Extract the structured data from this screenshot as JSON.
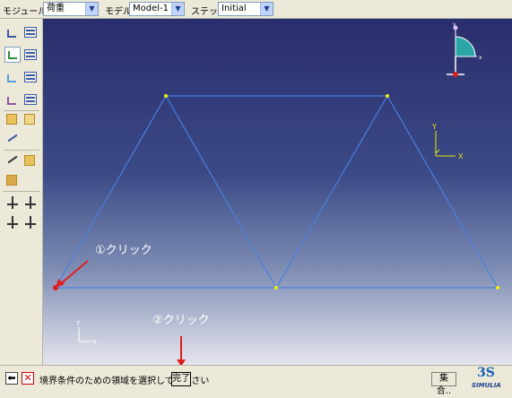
{
  "toolbar": {
    "module_label": "モジュール",
    "module_value": "荷重",
    "model_label": "モデル",
    "model_value": "Model-1",
    "step_label": "ステップ",
    "step_value": "Initial"
  },
  "left_tools": {
    "icons": [
      "load-manager-icon",
      "bc-manager-icon",
      "predefined-field-icon",
      "interaction-manager-icon",
      "create-load-icon",
      "create-bc-icon",
      "edit-icon",
      "select-icon",
      "set-icon",
      "csys-icon",
      "transform-icon"
    ]
  },
  "viewport": {
    "annotation_1": "①クリック",
    "annotation_2": "②クリック",
    "triad_x": "X",
    "triad_y": "Y",
    "mini_triad_x": "X",
    "mini_triad_y": "Y",
    "compass_x": "x",
    "compass_y": "y",
    "colors": {
      "truss": "#4a7fe0",
      "node": "#f2f200",
      "selected_node": "#e02020",
      "arrow": "#e02020",
      "triad": "#e8e800"
    }
  },
  "status": {
    "prompt": "境界条件のための領域を選択してください",
    "done_button": "完了",
    "set_button": "集合..",
    "logo": "SIMULIA"
  }
}
